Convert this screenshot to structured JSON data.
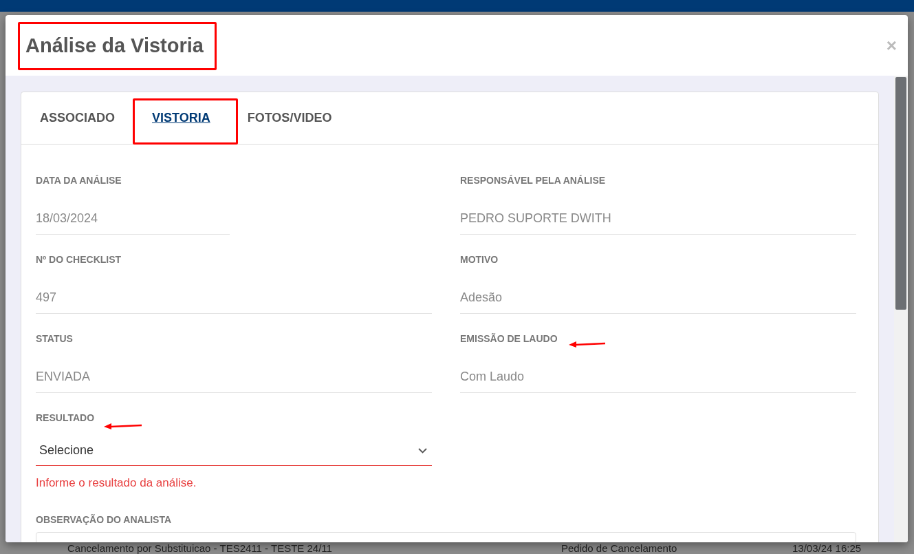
{
  "modal": {
    "title": "Análise da Vistoria",
    "close": "×"
  },
  "tabs": [
    {
      "label": "ASSOCIADO",
      "selected": false
    },
    {
      "label": "VISTORIA",
      "selected": true
    },
    {
      "label": "FOTOS/VIDEO",
      "selected": false
    }
  ],
  "fields": [
    {
      "label": "DATA DA ANÁLISE",
      "value": "18/03/2024",
      "kind": "short"
    },
    {
      "label": "RESPONSÁVEL PELA ANÁLISE",
      "value": "PEDRO SUPORTE DWITH",
      "kind": "text"
    },
    {
      "label": "Nº DO CHECKLIST",
      "value": "497",
      "kind": "text"
    },
    {
      "label": "MOTIVO",
      "value": "Adesão",
      "kind": "text"
    },
    {
      "label": "STATUS",
      "value": "ENVIADA",
      "kind": "text"
    },
    {
      "label": "EMISSÃO DE LAUDO",
      "value": "Com Laudo",
      "kind": "text"
    }
  ],
  "result": {
    "label": "RESULTADO",
    "value": "Selecione",
    "invalid": true,
    "error": "Informe o resultado da análise."
  },
  "observation": {
    "label": "OBSERVAÇÃO DO ANALISTA"
  },
  "background_row": [
    "Cancelamento por Substituicao - TES2411 - TESTE 24/11",
    "Pedido de Cancelamento",
    "13/03/24 16:25"
  ]
}
